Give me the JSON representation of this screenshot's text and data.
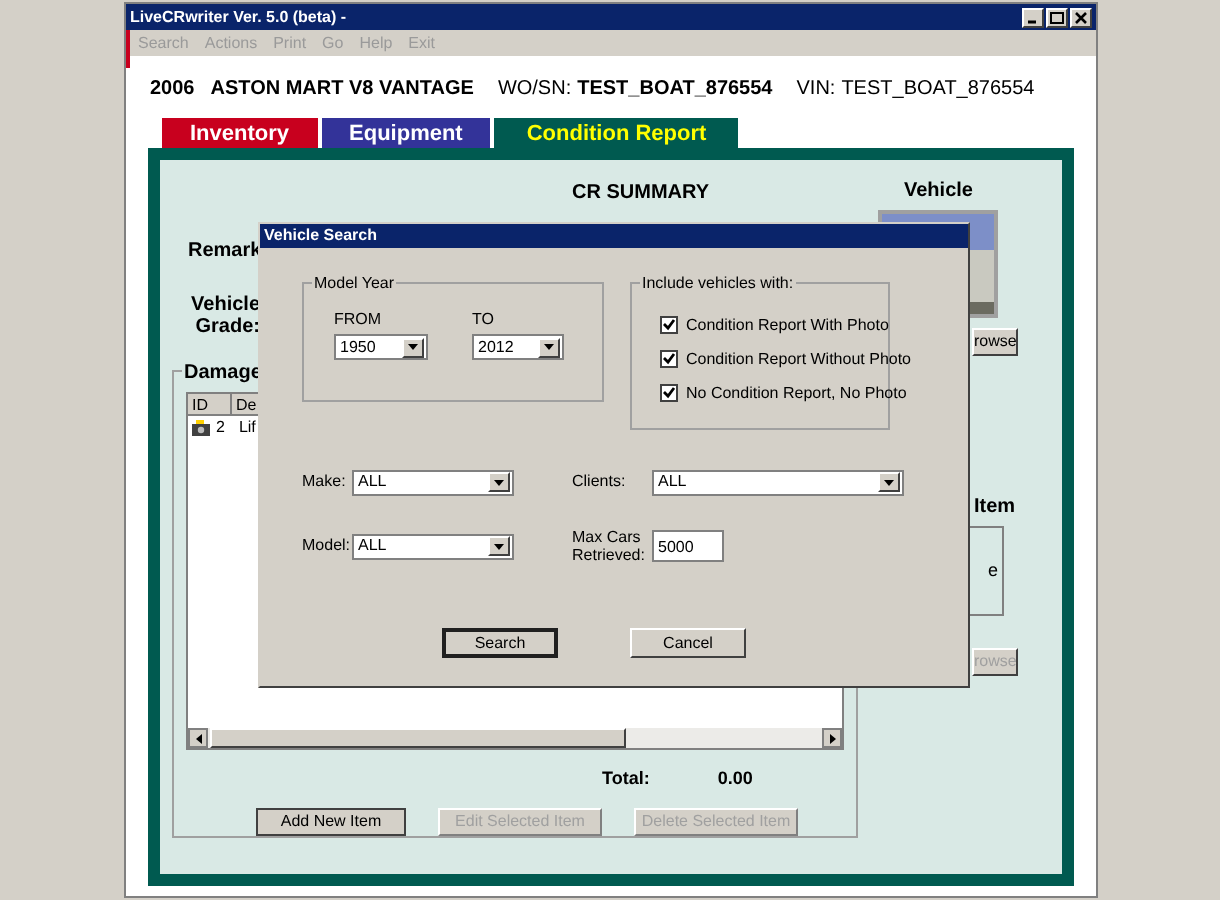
{
  "window": {
    "title": "LiveCRwriter Ver. 5.0 (beta) -"
  },
  "menu": [
    "Search",
    "Actions",
    "Print",
    "Go",
    "Help",
    "Exit"
  ],
  "header": {
    "year": "2006",
    "vehicle": "ASTON MART V8 VANTAGE",
    "wo_sn_label": "WO/SN:",
    "wo_sn": "TEST_BOAT_876554",
    "vin_label": "VIN:",
    "vin": "TEST_BOAT_876554"
  },
  "tabs": [
    {
      "label": "Inventory",
      "selected": false,
      "color": "#c8001e"
    },
    {
      "label": "Equipment",
      "selected": false,
      "color": "#333399"
    },
    {
      "label": "Condition Report",
      "selected": true,
      "color": "#005a50"
    }
  ],
  "summary": {
    "title": "CR SUMMARY",
    "remark_label": "Remark",
    "grade_label": [
      "Vehicle",
      "Grade:"
    ]
  },
  "damage": {
    "title": "Damage",
    "columns": [
      "ID",
      "De"
    ],
    "rows": [
      {
        "id": "2",
        "description": "Lif",
        "has_photo": true
      }
    ],
    "total_label": "Total:",
    "total": "0.00",
    "buttons": [
      {
        "label": "Add New Item",
        "disabled": false
      },
      {
        "label": "Edit Selected Item",
        "disabled": true
      },
      {
        "label": "Delete Selected Item",
        "disabled": true
      }
    ]
  },
  "vehicle_photo": {
    "title": "Vehicle",
    "browse": {
      "label": "rowse",
      "disabled": false
    }
  },
  "item_photo": {
    "title": "Item",
    "text": "e",
    "browse": {
      "label": "rowse",
      "disabled": true
    }
  },
  "dialog": {
    "title": "Vehicle Search",
    "model_year": {
      "title": "Model Year",
      "from_label": "FROM",
      "from": "1950",
      "to_label": "TO",
      "to": "2012"
    },
    "include": {
      "title": "Include vehicles with:",
      "options": [
        {
          "label": "Condition Report With Photo",
          "checked": true
        },
        {
          "label": "Condition Report Without Photo",
          "checked": true
        },
        {
          "label": "No Condition Report, No Photo",
          "checked": true
        }
      ]
    },
    "make_label": "Make:",
    "make": "ALL",
    "clients_label": "Clients:",
    "clients": "ALL",
    "model_label": "Model:",
    "model": "ALL",
    "max_cars_label": [
      "Max Cars",
      "Retrieved:"
    ],
    "max_cars": "5000",
    "buttons": [
      {
        "label": "Search",
        "default": true
      },
      {
        "label": "Cancel",
        "default": false
      }
    ]
  }
}
